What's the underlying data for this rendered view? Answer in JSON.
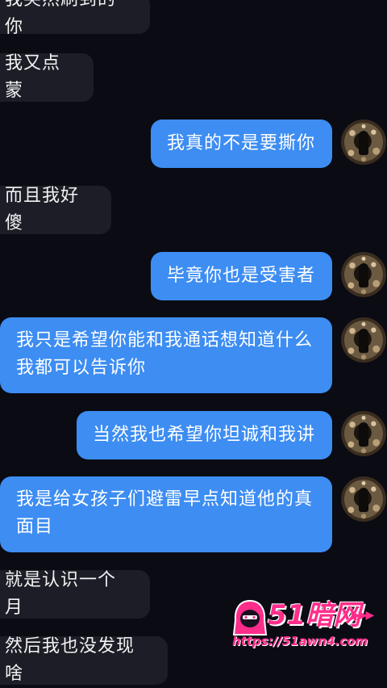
{
  "messages": [
    {
      "side": "incoming",
      "text": "我突然刷到的你"
    },
    {
      "side": "incoming",
      "text": "我又点蒙"
    },
    {
      "side": "outgoing",
      "text": "我真的不是要撕你"
    },
    {
      "side": "incoming",
      "text": "而且我好傻"
    },
    {
      "side": "outgoing",
      "text": "毕竟你也是受害者"
    },
    {
      "side": "outgoing",
      "text": "我只是希望你能和我通话想知道什么我都可以告诉你"
    },
    {
      "side": "outgoing",
      "text": "当然我也希望你坦诚和我讲"
    },
    {
      "side": "outgoing",
      "text": "我是给女孩子们避雷早点知道他的真面目"
    },
    {
      "side": "incoming",
      "text": "就是认识一个月"
    },
    {
      "side": "incoming",
      "text": "然后我也没发现啥"
    }
  ],
  "watermark": {
    "brand": "51暗网",
    "arrows": "▶▶▶",
    "url": "https://51awn4.com"
  },
  "colors": {
    "background": "#0b0b14",
    "incoming_bubble": "#1d1d27",
    "outgoing_bubble": "#3d8df2",
    "watermark": "#ff2d8a"
  }
}
